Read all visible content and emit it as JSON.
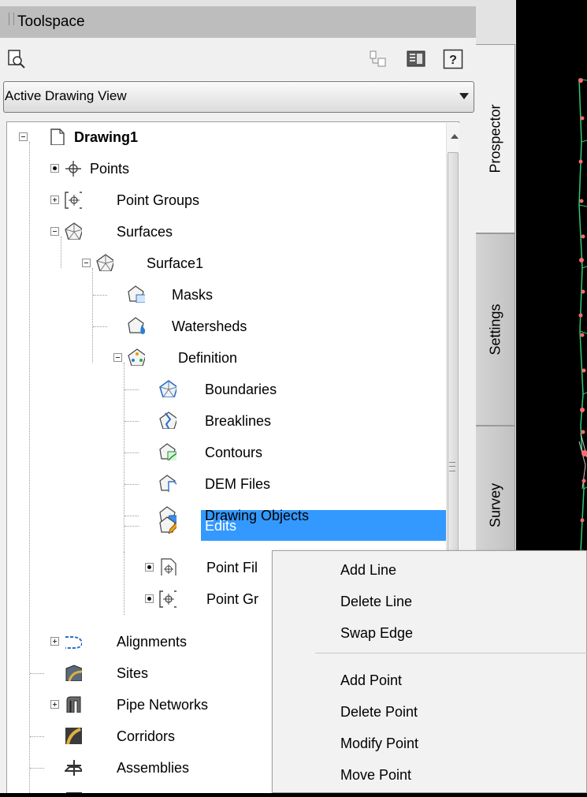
{
  "window": {
    "title": "Toolspace"
  },
  "combo": {
    "value": "Active Drawing View"
  },
  "tabs": {
    "prospector": "Prospector",
    "settings": "Settings",
    "survey": "Survey"
  },
  "tree": [
    {
      "label": "Drawing1",
      "bold": true
    },
    {
      "label": "Points"
    },
    {
      "label": "Point Groups"
    },
    {
      "label": "Surfaces"
    },
    {
      "label": "Surface1"
    },
    {
      "label": "Masks"
    },
    {
      "label": "Watersheds"
    },
    {
      "label": "Definition"
    },
    {
      "label": "Boundaries"
    },
    {
      "label": "Breaklines"
    },
    {
      "label": "Contours"
    },
    {
      "label": "DEM Files"
    },
    {
      "label": "Drawing Objects"
    },
    {
      "label": "Edits",
      "selected": true
    },
    {
      "label": "Point Fil"
    },
    {
      "label": "Point Gr"
    },
    {
      "label": "Alignments"
    },
    {
      "label": "Sites"
    },
    {
      "label": "Pipe Networks"
    },
    {
      "label": "Corridors"
    },
    {
      "label": "Assemblies"
    }
  ],
  "context_menu": {
    "group1": [
      "Add Line",
      "Delete Line",
      "Swap Edge"
    ],
    "group2": [
      "Add Point",
      "Delete Point",
      "Modify Point",
      "Move Point"
    ]
  },
  "icons": [
    "search-icon",
    "item-view-icon",
    "list-view-icon",
    "help-icon",
    "drawing-icon",
    "point-icon",
    "point-group-icon",
    "surface-icon",
    "alignment-icon",
    "site-icon",
    "pipe-network-icon",
    "corridor-icon",
    "assembly-icon"
  ],
  "colors": {
    "selection": "#3399ff",
    "surface_line": "#2ecc71",
    "points": "#ff6b6b"
  }
}
